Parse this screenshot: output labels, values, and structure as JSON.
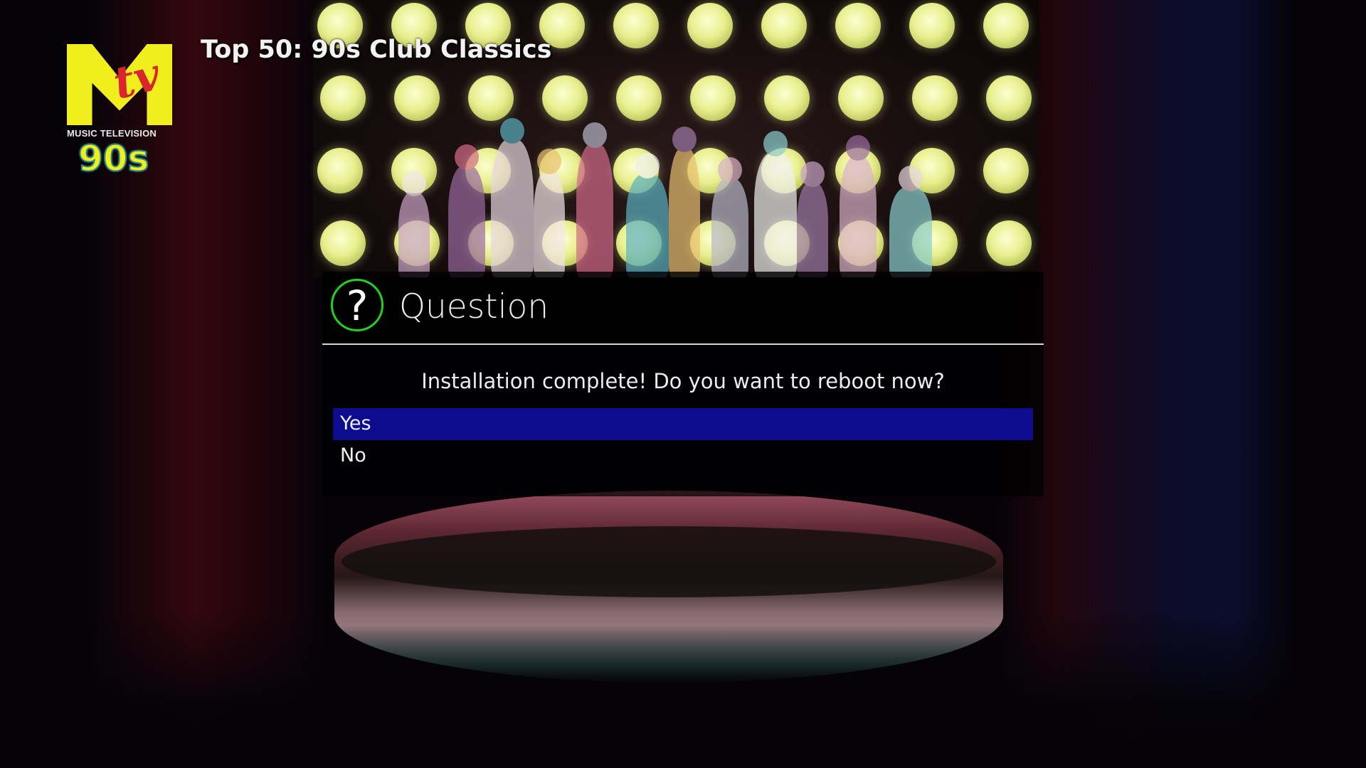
{
  "channel": {
    "logo_sub": "MUSIC TELEVISION",
    "logo_decade": "90s",
    "program_title": "Top 50: 90s Club Classics"
  },
  "dialog": {
    "title": "Question",
    "icon": "question-mark-icon",
    "message": "Installation complete! Do you want to reboot now?",
    "options": [
      {
        "label": "Yes",
        "selected": true
      },
      {
        "label": "No",
        "selected": false
      }
    ]
  },
  "colors": {
    "selection": "#0e0c8e",
    "icon_ring": "#21d221",
    "logo_yellow": "#f0ee1c",
    "logo_red": "#d8262c"
  }
}
